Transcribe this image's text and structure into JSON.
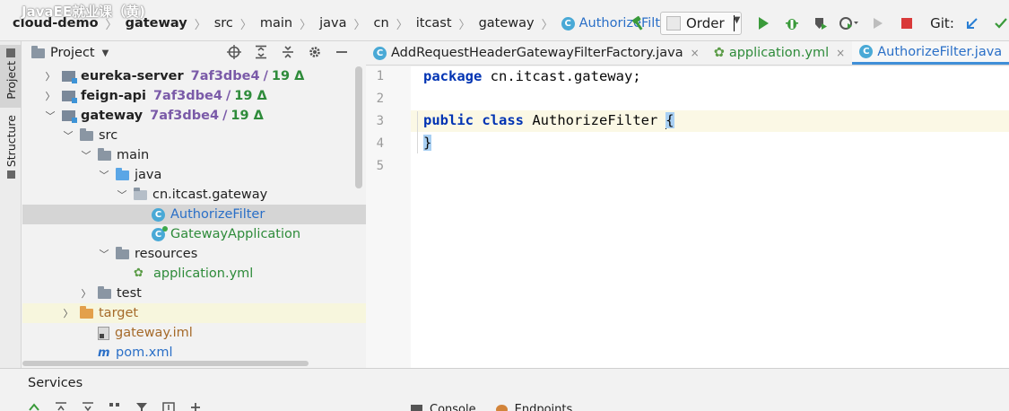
{
  "watermark": "JavaEE就业课（黄)",
  "breadcrumb": {
    "items": [
      "cloud-demo",
      "gateway",
      "src",
      "main",
      "java",
      "cn",
      "itcast",
      "gateway"
    ],
    "current_class": "AuthorizeFilter",
    "class_icon_letter": "C"
  },
  "toolbar": {
    "run_config": "Order",
    "git_label": "Git:",
    "build_icon": "hammer-icon",
    "run_icon": "run-icon",
    "debug_icon": "bug-icon",
    "coverage_icon": "shield-run-icon",
    "profile_icon": "profile-icon",
    "stop_icon": "stop-icon",
    "colors": {
      "run": "#3a9a3a",
      "stop": "#d93a3a",
      "git": "#2a7fd4"
    }
  },
  "left_strip": {
    "project_tab": "Project",
    "structure_tab": "Structure"
  },
  "project_panel": {
    "title": "Project",
    "tree": [
      {
        "name": "eureka-server",
        "hash": "7af3dbe4",
        "count": "19 Δ",
        "type": "module",
        "expanded": false
      },
      {
        "name": "feign-api",
        "hash": "7af3dbe4",
        "count": "19 Δ",
        "type": "module",
        "expanded": false
      },
      {
        "name": "gateway",
        "hash": "7af3dbe4",
        "count": "19 Δ",
        "type": "module",
        "expanded": true
      },
      {
        "name": "src",
        "type": "folder"
      },
      {
        "name": "main",
        "type": "folder"
      },
      {
        "name": "java",
        "type": "source-folder"
      },
      {
        "name": "cn.itcast.gateway",
        "type": "package"
      },
      {
        "name": "AuthorizeFilter",
        "type": "class"
      },
      {
        "name": "GatewayApplication",
        "type": "runnable-class"
      },
      {
        "name": "resources",
        "type": "resources-folder"
      },
      {
        "name": "application.yml",
        "type": "yml"
      },
      {
        "name": "test",
        "type": "folder"
      },
      {
        "name": "target",
        "type": "excluded-folder"
      },
      {
        "name": "gateway.iml",
        "type": "iml"
      },
      {
        "name": "pom.xml",
        "type": "maven"
      }
    ]
  },
  "editor": {
    "tabs": [
      {
        "label": "AddRequestHeaderGatewayFilterFactory.java",
        "icon": "C",
        "active": false
      },
      {
        "label": "application.yml",
        "icon": "yml",
        "active": false
      },
      {
        "label": "AuthorizeFilter.java",
        "icon": "C",
        "active": true
      },
      {
        "label": "",
        "icon": "I",
        "active": false
      }
    ],
    "close_glyph": "×",
    "line_numbers": [
      "1",
      "2",
      "3",
      "4",
      "5"
    ],
    "code": {
      "l1_kw": "package",
      "l1_rest": " cn.itcast.gateway;",
      "l3_kw1": "public",
      "l3_kw2": "class",
      "l3_rest": " AuthorizeFilter ",
      "l3_brace": "{",
      "l4_brace": "}"
    }
  },
  "services": {
    "title": "Services",
    "tabs": [
      "Console",
      "Endpoints"
    ]
  }
}
